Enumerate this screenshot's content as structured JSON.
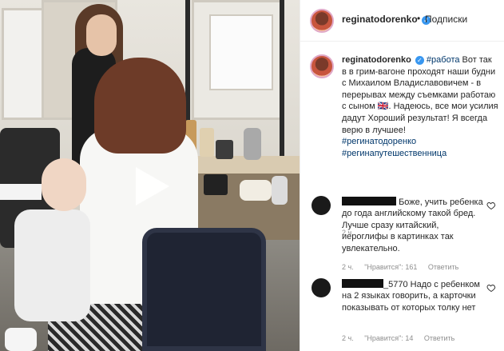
{
  "post": {
    "username": "reginatodorenko",
    "header_separator": "•",
    "follow_label": "Подписки",
    "verified_glyph": "✓",
    "media_type": "video",
    "caption": {
      "username": "reginatodorenko",
      "hashtag_work": "#работа",
      "body": "Вот так в в грим-вагоне проходят наши будни с Михаилом Владиславовичем - в перерывах между съемками работаю с сыном 🇬🇧. Надеюсь, все мои усилия дадут Хороший результат! Я всегда верю в лучшее!",
      "hashtag_1": "#регинатодоренко",
      "hashtag_2": "#регинапутешественница",
      "time": "2 ч."
    },
    "comments": [
      {
        "text": "Боже, учить ребенка до года английскому такой бред. Лучше сразу китайский, иероглифы в картинках так увлекательно.",
        "time": "2 ч.",
        "likes": "\"Нравится\": 161",
        "reply": "Ответить"
      },
      {
        "username_visible": "_5770",
        "text": "Надо с ребенком на 2 языках говорить, а карточки показывать от которых толку нет",
        "time": "2 ч.",
        "likes": "\"Нравится\": 14",
        "reply": "Ответить"
      }
    ]
  },
  "colors": {
    "link": "#00376b",
    "verified": "#3897f0",
    "meta": "#8e8e8e"
  },
  "icons": [
    "play-icon",
    "verified-icon",
    "heart-icon"
  ]
}
